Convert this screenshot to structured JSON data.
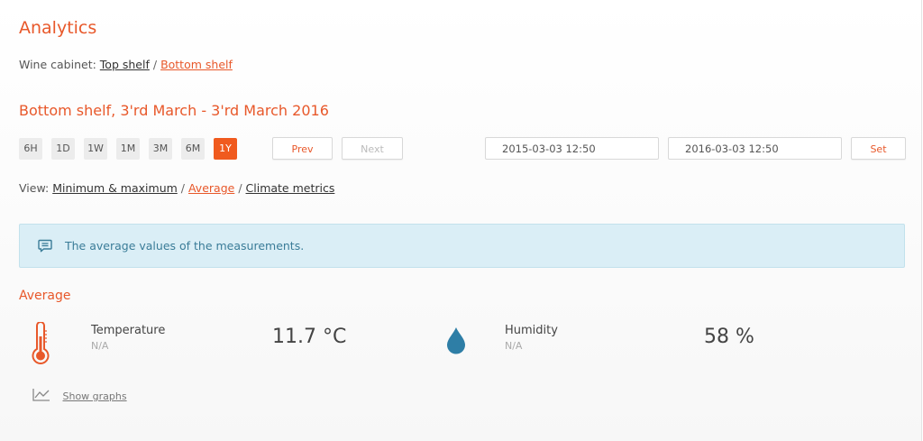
{
  "header": {
    "title": "Analytics"
  },
  "breadcrumb": {
    "prefix": "Wine cabinet:",
    "items": [
      "Top shelf",
      "Bottom shelf"
    ],
    "active_index": 1,
    "separator": "/"
  },
  "section": {
    "title": "Bottom shelf, 3'rd March - 3'rd March 2016"
  },
  "range_buttons": {
    "items": [
      "6H",
      "1D",
      "1W",
      "1M",
      "3M",
      "6M",
      "1Y"
    ],
    "active": "1Y"
  },
  "nav": {
    "prev_label": "Prev",
    "next_label": "Next"
  },
  "dates": {
    "from": "2015-03-03 12:50",
    "to": "2016-03-03 12:50",
    "set_label": "Set"
  },
  "view": {
    "prefix": "View:",
    "items": [
      "Minimum & maximum",
      "Average",
      "Climate metrics"
    ],
    "active": "Average",
    "separator": "/"
  },
  "info": {
    "icon": "message-icon",
    "text": "The average values of the measurements."
  },
  "average": {
    "title": "Average",
    "temperature": {
      "icon": "thermometer-icon",
      "label": "Temperature",
      "sub": "N/A",
      "value": "11.7 °C"
    },
    "humidity": {
      "icon": "water-drop-icon",
      "label": "Humidity",
      "sub": "N/A",
      "value": "58 %"
    }
  },
  "graphs": {
    "icon": "line-chart-icon",
    "label": "Show graphs"
  },
  "colors": {
    "accent": "#e8582a",
    "active_button": "#f05a1e",
    "info_bg": "#daeef6",
    "info_text": "#3a7c98",
    "drop": "#2e7ea6"
  }
}
